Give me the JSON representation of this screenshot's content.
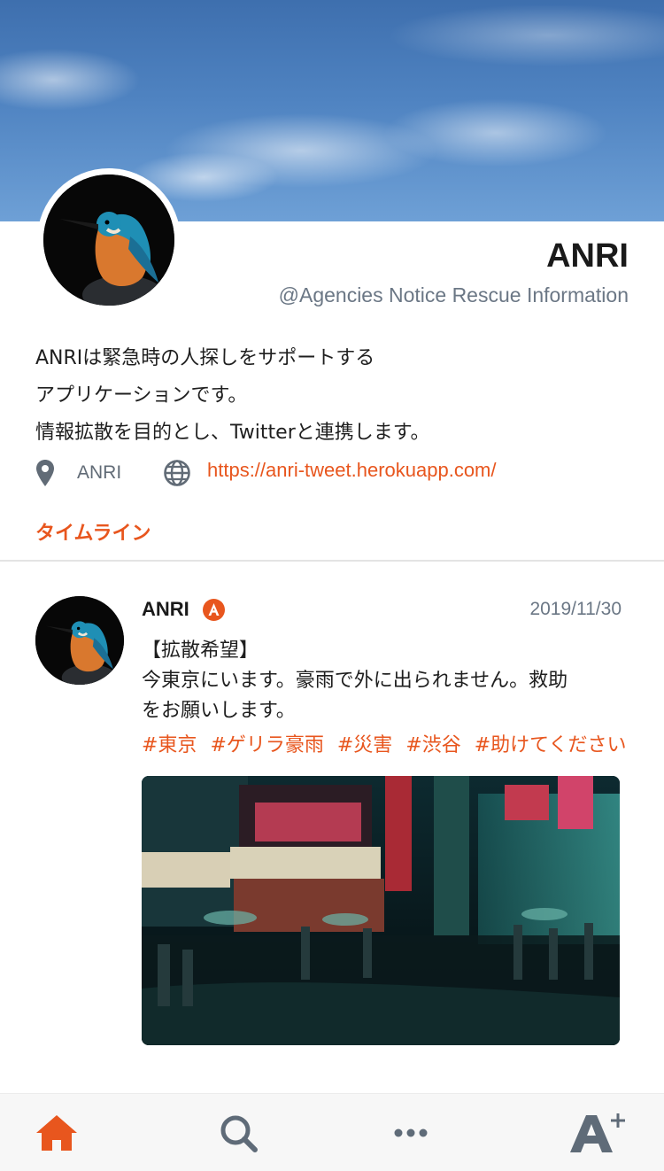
{
  "profile": {
    "name": "ANRI",
    "handle": "@Agencies Notice Rescue Information",
    "bio_lines": [
      "ANRIは緊急時の人探しをサポートする",
      "アプリケーションです。",
      "情報拡散を目的とし、Twitterと連携します。"
    ],
    "location": "ANRI",
    "website": "https://anri-tweet.herokuapp.com/",
    "location_icon": "map-pin-icon",
    "website_icon": "globe-icon"
  },
  "tabs": {
    "timeline": "タイムライン"
  },
  "post": {
    "author": "ANRI",
    "date": "2019/11/30",
    "text_lines": [
      "【拡散希望】",
      "今東京にいます。豪雨で外に出られません。救助",
      "をお願いします。"
    ],
    "hashtags": [
      "#東京",
      "#ゲリラ豪雨",
      "#災害",
      "#渋谷",
      "#助けてください"
    ],
    "badge_icon": "verified-a-badge-icon"
  },
  "nav": {
    "items": [
      "home-icon",
      "search-icon",
      "more-icon",
      "add-account-icon"
    ],
    "active": "home"
  },
  "colors": {
    "accent": "#e8561e",
    "muted": "#6b7785",
    "nav_inactive": "#5f6b78"
  }
}
